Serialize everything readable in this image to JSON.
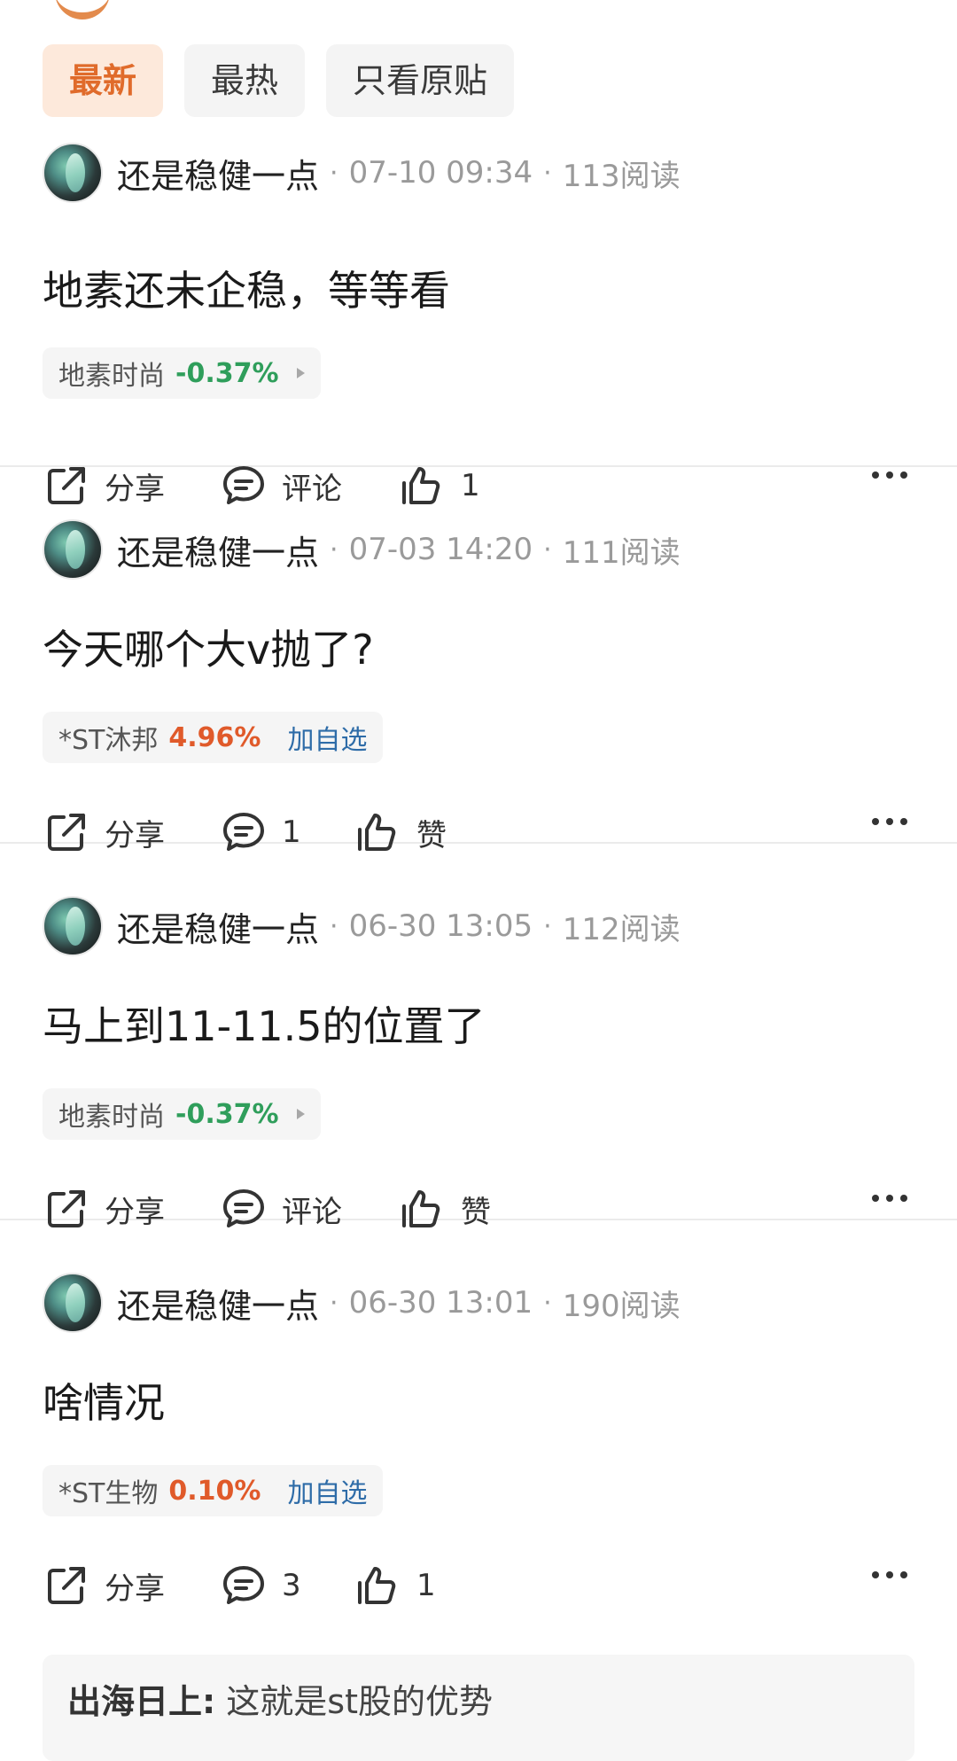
{
  "tabs": [
    {
      "label": "最新",
      "active": true
    },
    {
      "label": "最热",
      "active": false
    },
    {
      "label": "只看原贴",
      "active": false
    }
  ],
  "posts": [
    {
      "author": "还是稳健一点",
      "time": "07-10 09:34",
      "reads": "113阅读",
      "content": "地素还未企稳，等等看",
      "stock": {
        "name": "地素时尚",
        "change": "-0.37%",
        "direction": "down",
        "extra": ""
      },
      "actions": {
        "share": "分享",
        "comment": "评论",
        "like": "1"
      }
    },
    {
      "author": "还是稳健一点",
      "time": "07-03 14:20",
      "reads": "111阅读",
      "content": "今天哪个大v抛了?",
      "stock": {
        "name": "*ST沐邦",
        "change": "4.96%",
        "direction": "up",
        "extra": "加自选"
      },
      "actions": {
        "share": "分享",
        "comment": "1",
        "like": "赞"
      }
    },
    {
      "author": "还是稳健一点",
      "time": "06-30 13:05",
      "reads": "112阅读",
      "content": "马上到11-11.5的位置了",
      "stock": {
        "name": "地素时尚",
        "change": "-0.37%",
        "direction": "down",
        "extra": ""
      },
      "actions": {
        "share": "分享",
        "comment": "评论",
        "like": "赞"
      }
    },
    {
      "author": "还是稳健一点",
      "time": "06-30 13:01",
      "reads": "190阅读",
      "content": "啥情况",
      "stock": {
        "name": "*ST生物",
        "change": "0.10%",
        "direction": "up",
        "extra": "加自选"
      },
      "actions": {
        "share": "分享",
        "comment": "3",
        "like": "1"
      },
      "reply": {
        "user": "出海日上:",
        "text": "这就是st股的优势"
      }
    }
  ],
  "colors": {
    "accent": "#e06b2b",
    "down": "#2f9e5b",
    "up": "#e05a2a",
    "link": "#2e6ca8"
  }
}
